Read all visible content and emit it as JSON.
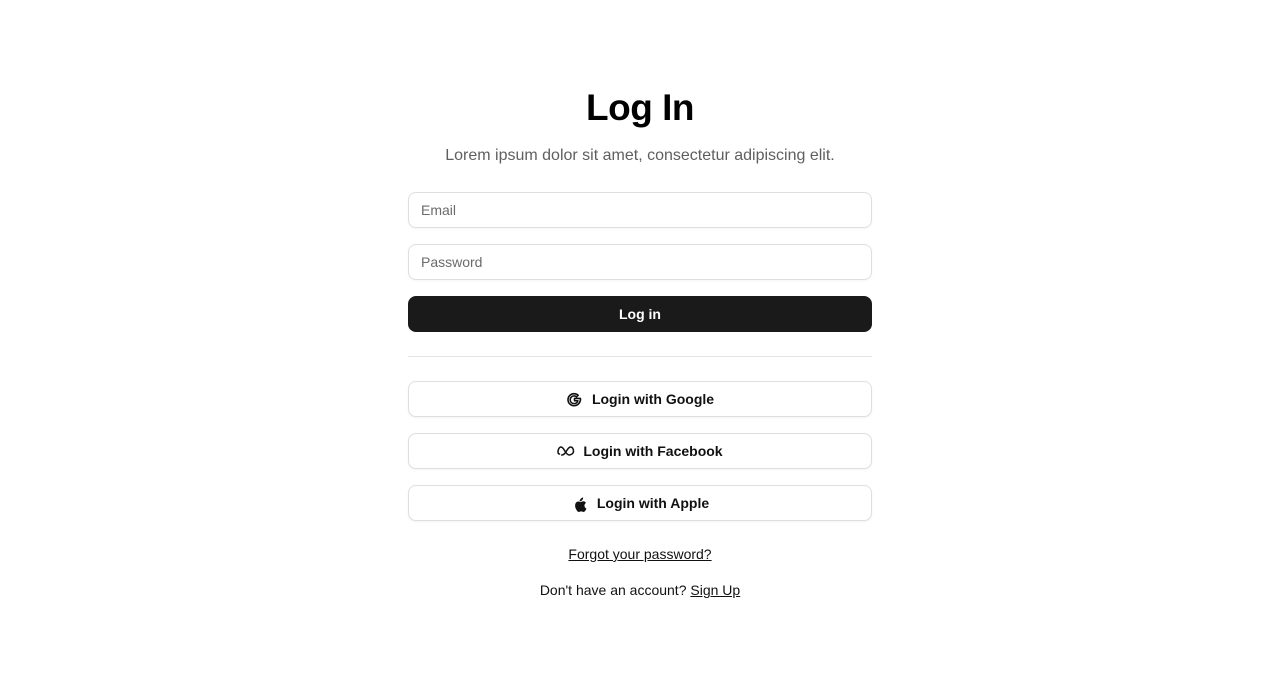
{
  "header": {
    "title": "Log In",
    "subtitle": "Lorem ipsum dolor sit amet, consectetur adipiscing elit."
  },
  "form": {
    "email_placeholder": "Email",
    "email_value": "",
    "password_placeholder": "Password",
    "password_value": "",
    "submit_label": "Log in"
  },
  "social": {
    "google_label": "Login with Google",
    "google_icon": "google-icon",
    "facebook_label": "Login with Facebook",
    "facebook_icon": "meta-icon",
    "apple_label": "Login with Apple",
    "apple_icon": "apple-icon"
  },
  "footer": {
    "forgot_label": "Forgot your password?",
    "no_account_text": "Don't have an account?",
    "signup_label": "Sign Up"
  },
  "colors": {
    "primary_button": "#1a1a1a",
    "subtitle_text": "#5f5f5f",
    "border": "#dedede"
  }
}
